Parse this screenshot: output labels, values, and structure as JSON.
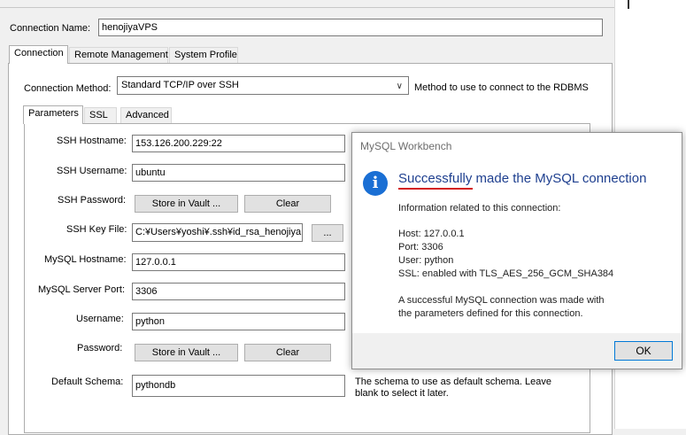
{
  "connection_name": {
    "label": "Connection Name:",
    "value": "henojiyaVPS"
  },
  "main_tabs": [
    {
      "label": "Connection"
    },
    {
      "label": "Remote Management"
    },
    {
      "label": "System Profile"
    }
  ],
  "connection_method": {
    "label": "Connection Method:",
    "value": "Standard TCP/IP over SSH",
    "help": "Method to use to connect to the RDBMS"
  },
  "sub_tabs": [
    {
      "label": "Parameters"
    },
    {
      "label": "SSL"
    },
    {
      "label": "Advanced"
    }
  ],
  "params": {
    "ssh_hostname": {
      "label": "SSH Hostname:",
      "value": "153.126.200.229:22"
    },
    "ssh_username": {
      "label": "SSH Username:",
      "value": "ubuntu"
    },
    "ssh_password": {
      "label": "SSH Password:",
      "store_label": "Store in Vault ...",
      "clear_label": "Clear"
    },
    "ssh_key_file": {
      "label": "SSH Key File:",
      "value": "C:¥Users¥yoshi¥.ssh¥id_rsa_henojiya",
      "browse_label": "..."
    },
    "mysql_hostname": {
      "label": "MySQL Hostname:",
      "value": "127.0.0.1"
    },
    "mysql_port": {
      "label": "MySQL Server Port:",
      "value": "3306"
    },
    "username": {
      "label": "Username:",
      "value": "python"
    },
    "password": {
      "label": "Password:",
      "store_label": "Store in Vault ...",
      "clear_label": "Clear"
    },
    "default_schema": {
      "label": "Default Schema:",
      "value": "pythondb",
      "help_line1": "The schema to use as default schema. Leave",
      "help_line2": "blank to select it later."
    }
  },
  "dialog": {
    "title": "MySQL Workbench",
    "icon": "info-icon",
    "heading": "Successfully made the MySQL connection",
    "intro": "Information related to this connection:",
    "host": "Host: 127.0.0.1",
    "port": "Port: 3306",
    "user": "User: python",
    "ssl": "SSL: enabled with TLS_AES_256_GCM_SHA384",
    "message_line1": "A successful MySQL connection was made with",
    "message_line2": "the parameters defined for this connection.",
    "ok_label": "OK",
    "underline_color": "#d31c1c"
  }
}
